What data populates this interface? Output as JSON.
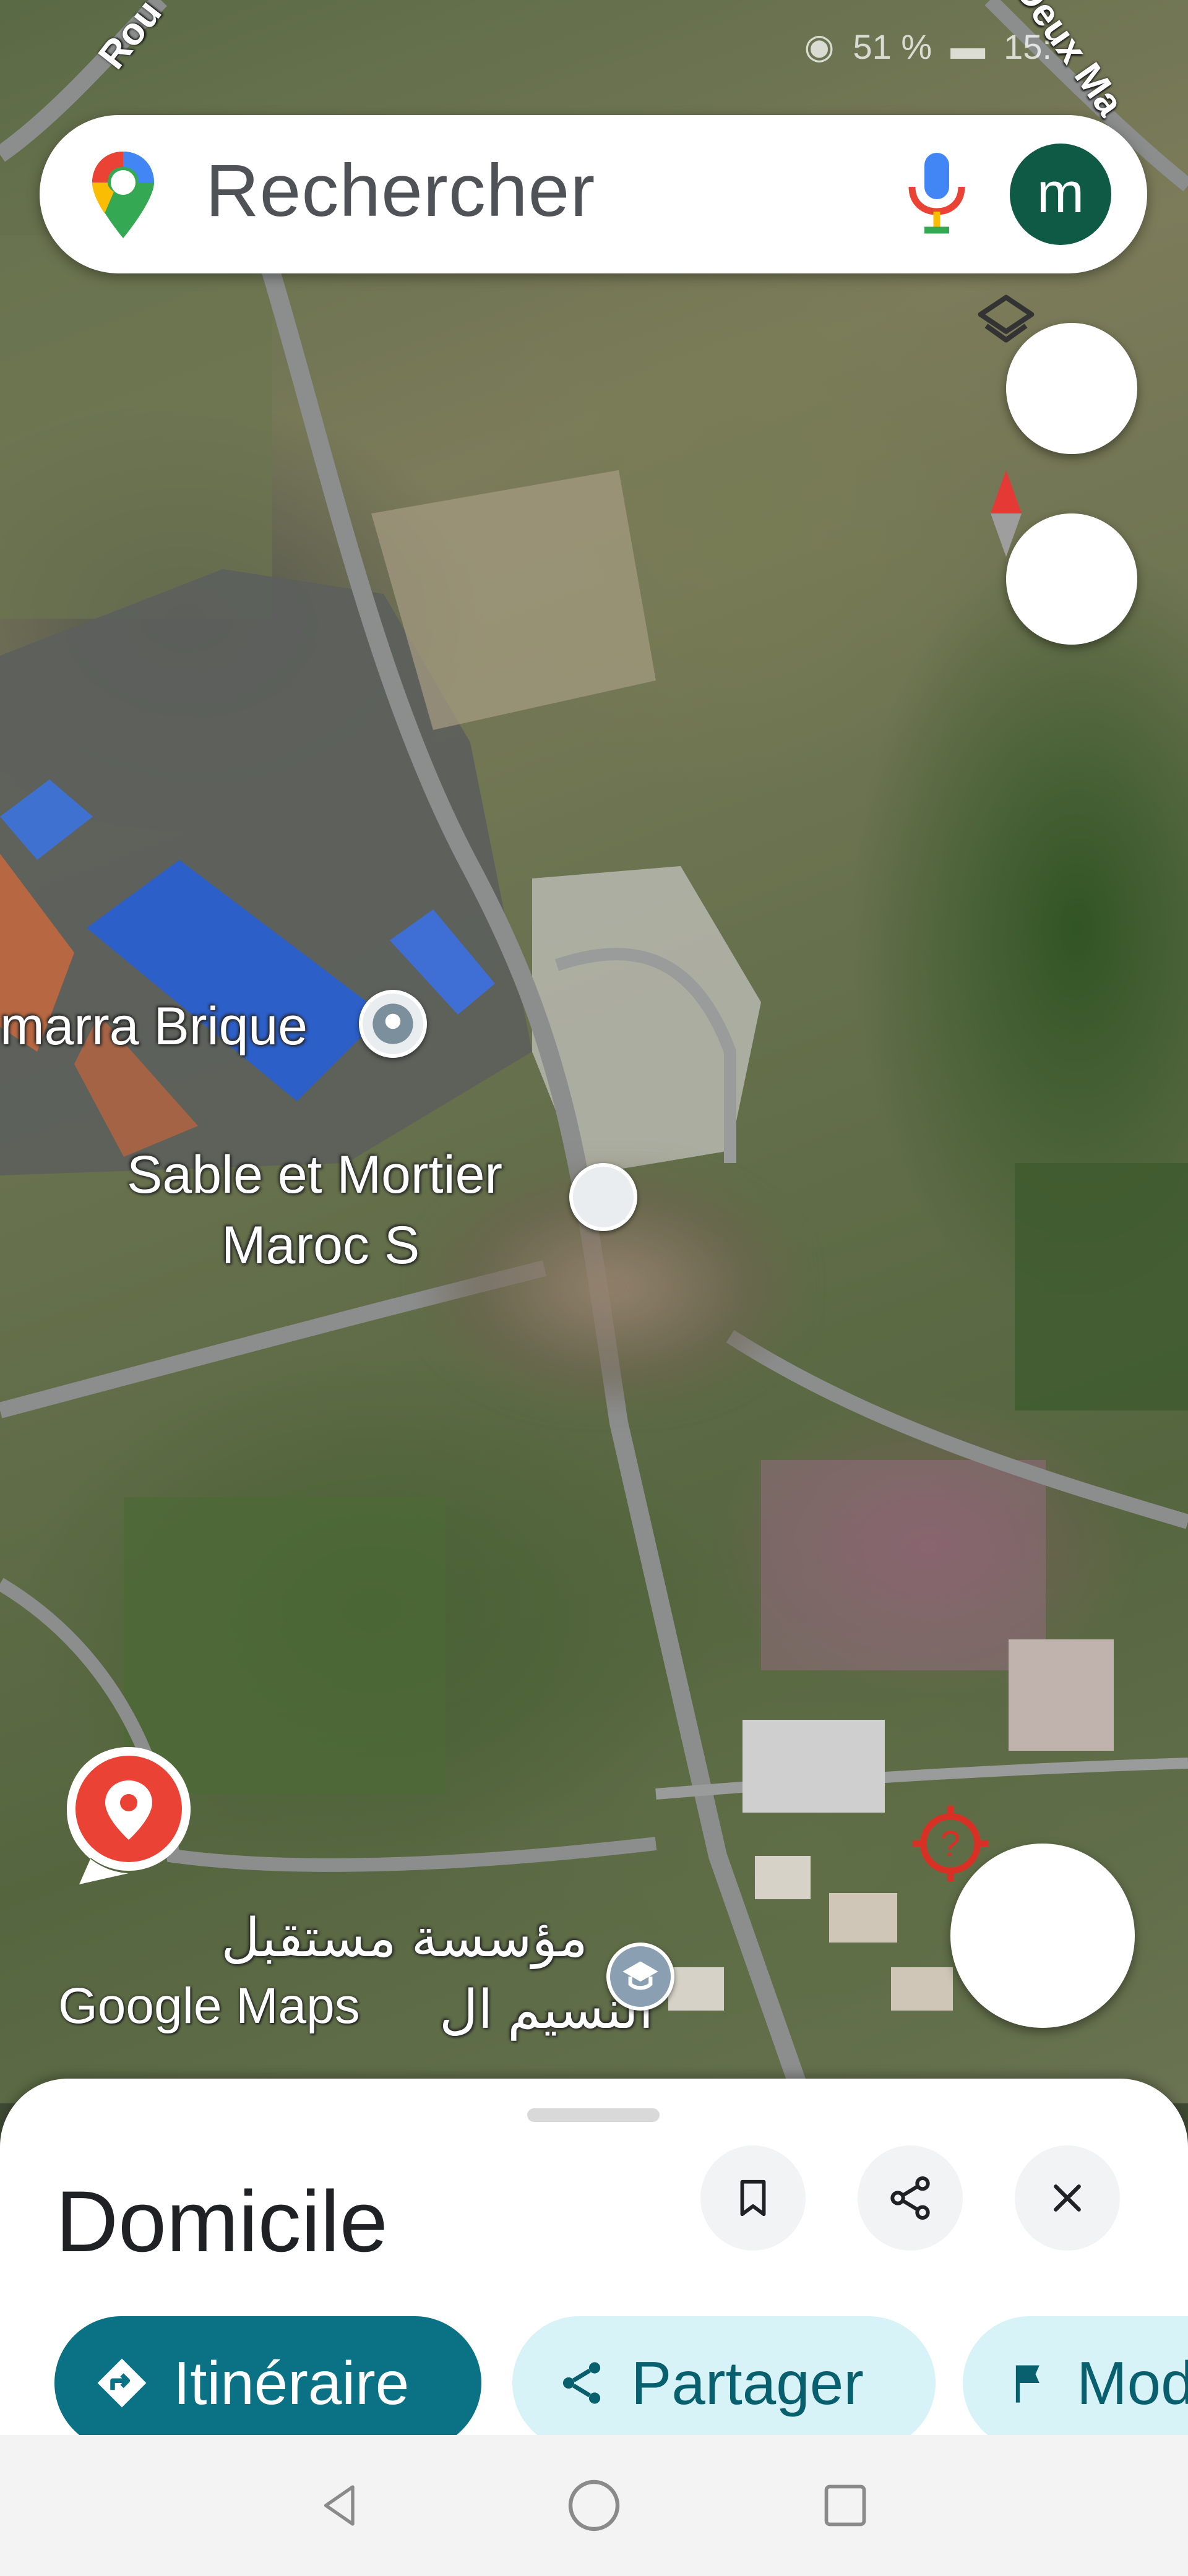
{
  "status_bar": {
    "battery_text": "51 %",
    "time_text": "15:"
  },
  "map": {
    "labels": {
      "place1": "marra Brique",
      "place2_line1": "Sable et Mortier",
      "place2_line2": "Maroc S",
      "school_line1": "مؤسسة مستقبل",
      "school_line2": "النسيم ال",
      "road_top_left": "Rou",
      "road_top_right": "Deux Ma"
    },
    "logo": "Google Maps"
  },
  "search": {
    "placeholder": "Rechercher",
    "avatar_initial": "m"
  },
  "sheet": {
    "title": "Domicile",
    "chips": {
      "route": "Itinéraire",
      "share": "Partager",
      "more": "Mod"
    }
  },
  "colors": {
    "accent": "#0b7285",
    "chip_light": "#d8f3f8",
    "pin_red": "#ea4335",
    "avatar": "#0f5a45"
  }
}
